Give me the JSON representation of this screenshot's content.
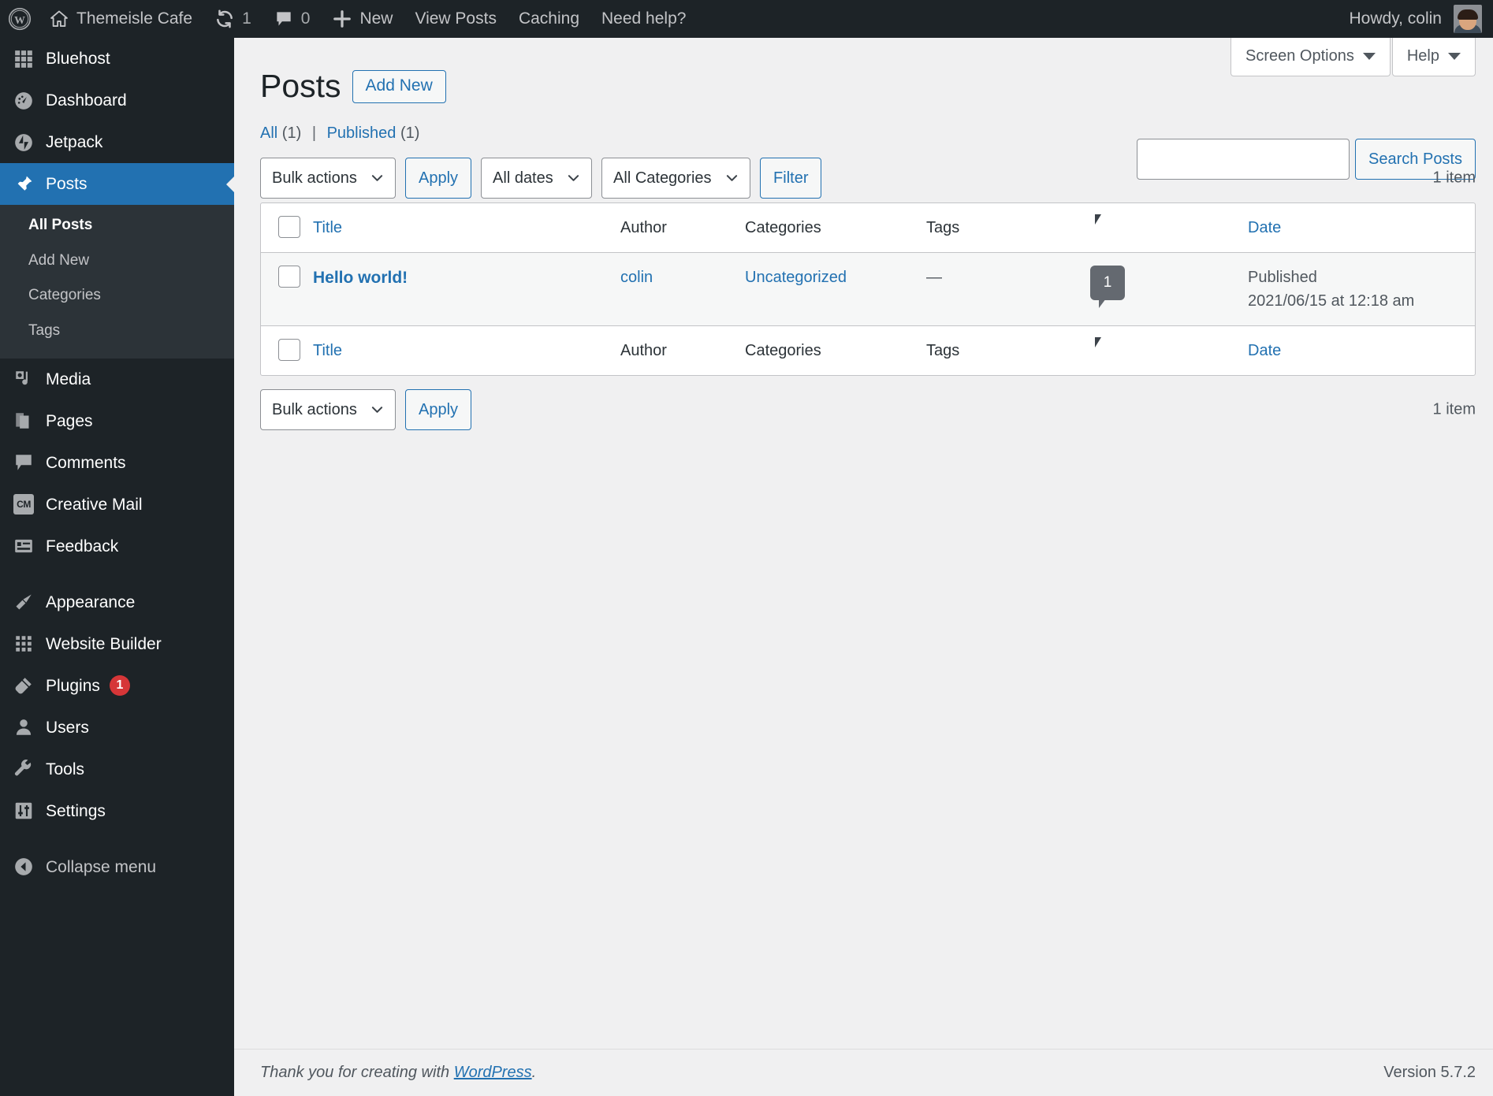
{
  "adminbar": {
    "wp_logo": "wordpress-logo",
    "site_name": "Themeisle Cafe",
    "updates_count": "1",
    "comments_count": "0",
    "new_label": "New",
    "view_posts_label": "View Posts",
    "caching_label": "Caching",
    "help_label": "Need help?",
    "howdy": "Howdy, colin"
  },
  "sidebar": {
    "items": [
      {
        "label": "Bluehost",
        "icon": "grid-icon",
        "current": false
      },
      {
        "label": "Dashboard",
        "icon": "dashboard-icon",
        "current": false
      },
      {
        "label": "Jetpack",
        "icon": "jetpack-icon",
        "current": false
      },
      {
        "label": "Posts",
        "icon": "pin-icon",
        "current": true
      },
      {
        "label": "Media",
        "icon": "media-icon",
        "current": false
      },
      {
        "label": "Pages",
        "icon": "pages-icon",
        "current": false
      },
      {
        "label": "Comments",
        "icon": "comment-icon",
        "current": false
      },
      {
        "label": "Creative Mail",
        "icon": "creative-mail-icon",
        "current": false
      },
      {
        "label": "Feedback",
        "icon": "feedback-icon",
        "current": false
      },
      {
        "label": "Appearance",
        "icon": "paintbrush-icon",
        "current": false
      },
      {
        "label": "Website Builder",
        "icon": "grid-icon",
        "current": false
      },
      {
        "label": "Plugins",
        "icon": "plug-icon",
        "current": false,
        "badge": "1"
      },
      {
        "label": "Users",
        "icon": "user-icon",
        "current": false
      },
      {
        "label": "Tools",
        "icon": "wrench-icon",
        "current": false
      },
      {
        "label": "Settings",
        "icon": "sliders-icon",
        "current": false
      }
    ],
    "submenu": [
      {
        "label": "All Posts",
        "current": true
      },
      {
        "label": "Add New",
        "current": false
      },
      {
        "label": "Categories",
        "current": false
      },
      {
        "label": "Tags",
        "current": false
      }
    ],
    "collapse_label": "Collapse menu"
  },
  "screen_meta": {
    "screen_options_label": "Screen Options",
    "help_label": "Help"
  },
  "page": {
    "title": "Posts",
    "add_new_label": "Add New"
  },
  "views": {
    "all_label": "All",
    "all_count": "(1)",
    "divider": "|",
    "published_label": "Published",
    "published_count": "(1)"
  },
  "search": {
    "value": "",
    "placeholder": "",
    "button_label": "Search Posts"
  },
  "tablenav_top": {
    "bulk_actions_selected": "Bulk actions",
    "apply_label": "Apply",
    "dates_selected": "All dates",
    "categories_selected": "All Categories",
    "filter_label": "Filter",
    "count_label": "1 item"
  },
  "tablenav_bottom": {
    "bulk_actions_selected": "Bulk actions",
    "apply_label": "Apply",
    "count_label": "1 item"
  },
  "table": {
    "columns": {
      "title": "Title",
      "author": "Author",
      "categories": "Categories",
      "tags": "Tags",
      "comments": "comment-icon",
      "date": "Date"
    },
    "rows": [
      {
        "title": "Hello world!",
        "author": "colin",
        "categories": "Uncategorized",
        "tags": "—",
        "comments": "1",
        "date_status": "Published",
        "date_value": "2021/06/15 at 12:18 am"
      }
    ]
  },
  "footer": {
    "thanks_prefix": "Thank you for creating with ",
    "wordpress_link": "WordPress",
    "thanks_suffix": ".",
    "version": "Version 5.7.2"
  },
  "colors": {
    "admin_blue": "#2271b1",
    "sidebar_bg": "#1d2327",
    "submenu_bg": "#2c3338",
    "badge_red": "#d63638",
    "page_bg": "#f0f0f1"
  }
}
